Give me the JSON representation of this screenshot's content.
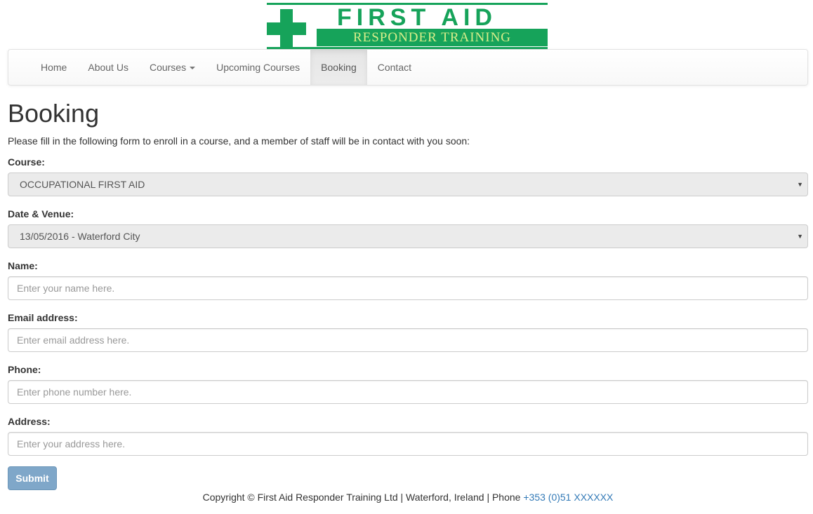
{
  "logo": {
    "title": "FIRST AID",
    "subtitle": "RESPONDER TRAINING",
    "brand_color": "#16a35a",
    "subtitle_text_color": "#d8ee8a",
    "icon": "green-cross-icon"
  },
  "nav": {
    "items": [
      {
        "label": "Home"
      },
      {
        "label": "About Us"
      },
      {
        "label": "Courses",
        "icon": "caret-down-icon"
      },
      {
        "label": "Upcoming Courses"
      },
      {
        "label": "Booking",
        "active": true
      },
      {
        "label": "Contact"
      }
    ]
  },
  "page": {
    "title": "Booking",
    "intro": "Please fill in the following form to enroll in a course, and a member of staff will be in contact with you soon:"
  },
  "form": {
    "course": {
      "label": "Course:",
      "value": "OCCUPATIONAL FIRST AID"
    },
    "date_venue": {
      "label": "Date & Venue:",
      "value": "13/05/2016 - Waterford City"
    },
    "name": {
      "label": "Name:",
      "placeholder": "Enter your name here."
    },
    "email": {
      "label": "Email address:",
      "placeholder": "Enter email address here."
    },
    "phone": {
      "label": "Phone:",
      "placeholder": "Enter phone number here."
    },
    "address": {
      "label": "Address:",
      "placeholder": "Enter your address here."
    },
    "submit_label": "Submit",
    "select_arrow": "▼"
  },
  "footer": {
    "text": "Copyright © First Aid Responder Training Ltd | Waterford, Ireland | Phone",
    "phone": "+353 (0)51 XXXXXX",
    "link_color": "#337ab7"
  }
}
